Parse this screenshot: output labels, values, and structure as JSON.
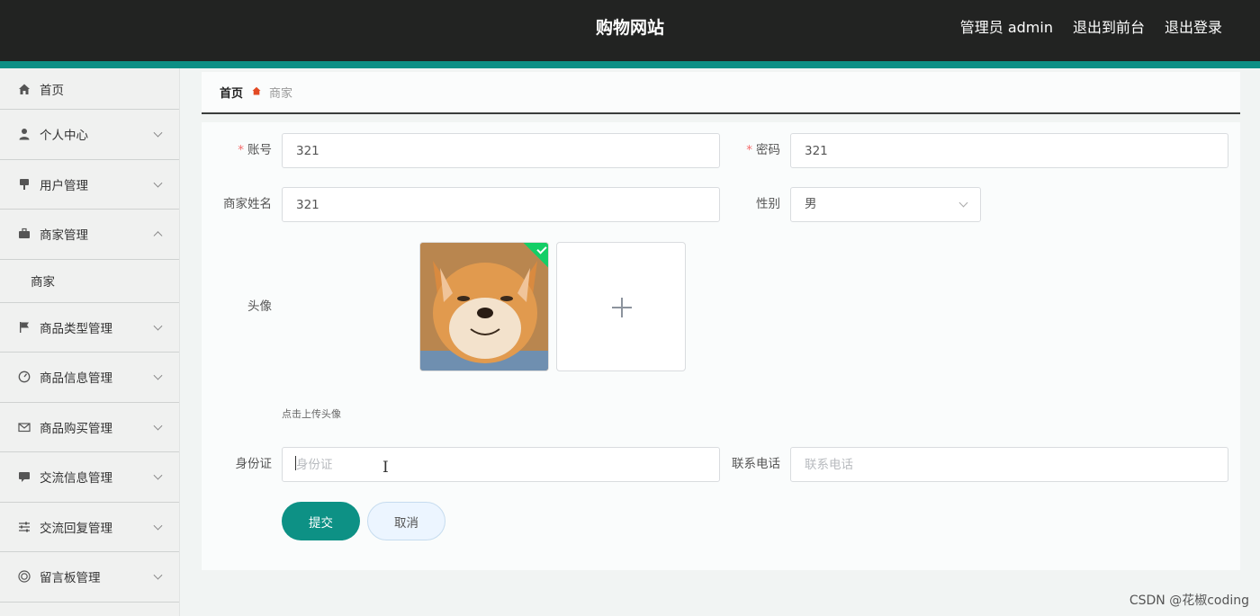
{
  "header": {
    "title": "购物网站",
    "user": "管理员 admin",
    "to_front": "退出到前台",
    "logout": "退出登录"
  },
  "sidebar": {
    "items": [
      {
        "label": "首页",
        "icon": "home-icon"
      },
      {
        "label": "个人中心",
        "icon": "user-icon"
      },
      {
        "label": "用户管理",
        "icon": "pin-icon"
      },
      {
        "label": "商家管理",
        "icon": "briefcase-icon",
        "expanded": true
      },
      {
        "label": "商家",
        "sub": true
      },
      {
        "label": "商品类型管理",
        "icon": "flag-icon"
      },
      {
        "label": "商品信息管理",
        "icon": "gauge-icon"
      },
      {
        "label": "商品购买管理",
        "icon": "mail-icon"
      },
      {
        "label": "交流信息管理",
        "icon": "chat-icon"
      },
      {
        "label": "交流回复管理",
        "icon": "sliders-icon"
      },
      {
        "label": "留言板管理",
        "icon": "target-icon"
      }
    ]
  },
  "breadcrumb": {
    "home": "首页",
    "current": "商家"
  },
  "form": {
    "account_label": "账号",
    "account_value": "321",
    "password_label": "密码",
    "password_value": "321",
    "name_label": "商家姓名",
    "name_value": "321",
    "gender_label": "性别",
    "gender_value": "男",
    "avatar_label": "头像",
    "upload_hint": "点击上传头像",
    "idcard_label": "身份证",
    "idcard_placeholder": "身份证",
    "phone_label": "联系电话",
    "phone_placeholder": "联系电话",
    "submit": "提交",
    "cancel": "取消"
  },
  "colors": {
    "header_bg": "#222322",
    "accent": "#0d8f85",
    "success": "#13ce66",
    "required": "#f56c6c"
  },
  "watermark": "CSDN @花椒coding"
}
